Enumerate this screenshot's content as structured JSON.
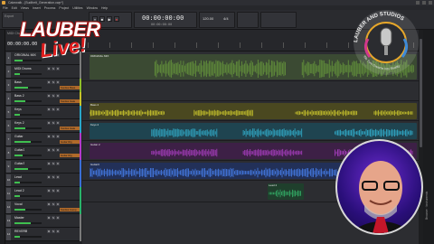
{
  "window": {
    "title": "Cakewalk - [Sudiheit_Generation.cwp*]",
    "menus": [
      "File",
      "Edit",
      "Views",
      "Insert",
      "Process",
      "Project",
      "Utilities",
      "Window",
      "Help"
    ]
  },
  "controlbar": {
    "preset": "Export",
    "time_primary": "00:00:00:00",
    "time_secondary": "00:00:00:00",
    "tempo": "120.00",
    "meter": "4/4",
    "transport_icons": [
      "rewind-icon",
      "stop-icon",
      "play-icon",
      "record-icon"
    ]
  },
  "trackpane": {
    "header_label": "MIDI Channel",
    "time_readout": "00:00:00.00"
  },
  "tracks": [
    {
      "num": "1",
      "name": "ORIGINAL MIX",
      "fx": "",
      "meter": 0.3,
      "color": "#7a7a7a"
    },
    {
      "num": "2",
      "name": "MIDI Drums",
      "fx": "",
      "meter": 0.2,
      "color": "#7a7a7a"
    },
    {
      "num": "3",
      "name": "Bass",
      "fx": "Sonitus Bass",
      "meter": 0.5,
      "color": "#8fbf2a"
    },
    {
      "num": "4",
      "name": "Bass 2",
      "fx": "Sonitus Gate",
      "meter": 0.4,
      "color": "#c9c22a"
    },
    {
      "num": "5",
      "name": "Keys",
      "fx": "",
      "meter": 0.2,
      "color": "#2aa6c9"
    },
    {
      "num": "6",
      "name": "Keys 2",
      "fx": "Sonitus Gate",
      "meter": 0.4,
      "color": "#2aa6c9"
    },
    {
      "num": "7",
      "name": "Guitar",
      "fx": "Guitar Rig",
      "meter": 0.6,
      "color": "#b33ac9"
    },
    {
      "num": "8",
      "name": "Guitar2",
      "fx": "Guitar Rig",
      "meter": 0.3,
      "color": "#b33ac9"
    },
    {
      "num": "9",
      "name": "Guitar3",
      "fx": "",
      "meter": 0.5,
      "color": "#3a6fd6"
    },
    {
      "num": "10",
      "name": "Lead",
      "fx": "",
      "meter": 0.2,
      "color": "#3a6fd6"
    },
    {
      "num": "11",
      "name": "Lead 2",
      "fx": "",
      "meter": 0.2,
      "color": "#2ab36a"
    },
    {
      "num": "12",
      "name": "Vocal",
      "fx": "Sonitus Comp",
      "meter": 0.4,
      "color": "#2ab36a"
    },
    {
      "num": "13",
      "name": "Master",
      "fx": "",
      "meter": 0.6,
      "color": "#7a7a7a"
    },
    {
      "num": "14",
      "name": "REVERB",
      "fx": "",
      "meter": 0.2,
      "color": "#7a7a7a"
    }
  ],
  "clip_titles": {
    "original": "ORIGINAL MIX",
    "bass": "Bass 2",
    "keys": "Keys 2",
    "guitar": "Guitar 2",
    "guitar3": "Guitar3",
    "lead": "Lead 2"
  },
  "clip_colors": {
    "original": "#5f8a3a",
    "bass": "#b8b42a",
    "keys": "#2e9cb8",
    "guitar": "#9a3ab0",
    "guitar3": "#3f6fd0",
    "lead": "#2f9a5c"
  },
  "overlay": {
    "brand_line1": "LAUBER",
    "brand_line2": "Live!",
    "studio_name": "LAUBER AND STUDIOS",
    "studio_tagline": "We Turn Dreams Into Reality"
  },
  "rightbar": {
    "label": "Browser · Instruments"
  }
}
